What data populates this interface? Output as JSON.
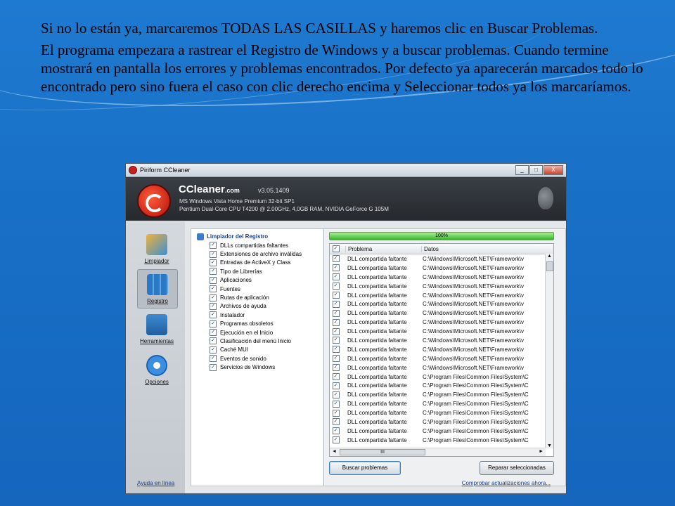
{
  "slide": {
    "paragraph1": "Si no lo están ya, marcaremos TODAS LAS CASILLAS y haremos clic en Buscar Problemas.",
    "paragraph2": "El programa empezara a rastrear el Registro de Windows y a buscar problemas. Cuando termine mostrará en pantalla los errores y problemas encontrados. Por defecto ya aparecerán marcados todo lo encontrado pero sino fuera el caso con clic derecho encima y Seleccionar todos ya los marcaríamos."
  },
  "window": {
    "title": "Piriform CCleaner",
    "controls": [
      "_",
      "□",
      "X"
    ]
  },
  "header": {
    "app_name": "CCleaner",
    "app_suffix": ".com",
    "version": "v3.05.1409",
    "os_line": "MS Windows Vista Home Premium 32-bit SP1",
    "cpu_line": "Pentium Dual-Core CPU T4200 @ 2.00GHz, 4,0GB RAM, NVIDIA GeForce G 105M"
  },
  "sidebar": {
    "items": [
      {
        "label": "Limpiador",
        "icon": "broom-icon"
      },
      {
        "label": "Registro",
        "icon": "registry-icon"
      },
      {
        "label": "Herramientas",
        "icon": "toolbox-icon"
      },
      {
        "label": "Opciones",
        "icon": "gear-icon"
      }
    ],
    "active": "Registro"
  },
  "tree": {
    "root": "Limpiador del Registro",
    "items": [
      "DLLs compartidas faltantes",
      "Extensiones de archivo inválidas",
      "Entradas de ActiveX y Class",
      "Tipo de Librerías",
      "Aplicaciones",
      "Fuentes",
      "Rutas de aplicación",
      "Archivos de ayuda",
      "Instalador",
      "Programas obsoletos",
      "Ejecución en el Inicio",
      "Clasificación del menú Inicio",
      "Caché MUI",
      "Eventos de sonido",
      "Servicios de Windows"
    ]
  },
  "progress": {
    "label": "100%",
    "value": 100
  },
  "results": {
    "columns": [
      "Problema",
      "Datos"
    ],
    "rows": [
      {
        "problem": "DLL compartida faltante",
        "data": "C:\\Windows\\Microsoft.NET\\Framework\\v"
      },
      {
        "problem": "DLL compartida faltante",
        "data": "C:\\Windows\\Microsoft.NET\\Framework\\v"
      },
      {
        "problem": "DLL compartida faltante",
        "data": "C:\\Windows\\Microsoft.NET\\Framework\\v"
      },
      {
        "problem": "DLL compartida faltante",
        "data": "C:\\Windows\\Microsoft.NET\\Framework\\v"
      },
      {
        "problem": "DLL compartida faltante",
        "data": "C:\\Windows\\Microsoft.NET\\Framework\\v"
      },
      {
        "problem": "DLL compartida faltante",
        "data": "C:\\Windows\\Microsoft.NET\\Framework\\v"
      },
      {
        "problem": "DLL compartida faltante",
        "data": "C:\\Windows\\Microsoft.NET\\Framework\\v"
      },
      {
        "problem": "DLL compartida faltante",
        "data": "C:\\Windows\\Microsoft.NET\\Framework\\v"
      },
      {
        "problem": "DLL compartida faltante",
        "data": "C:\\Windows\\Microsoft.NET\\Framework\\v"
      },
      {
        "problem": "DLL compartida faltante",
        "data": "C:\\Windows\\Microsoft.NET\\Framework\\v"
      },
      {
        "problem": "DLL compartida faltante",
        "data": "C:\\Windows\\Microsoft.NET\\Framework\\v"
      },
      {
        "problem": "DLL compartida faltante",
        "data": "C:\\Windows\\Microsoft.NET\\Framework\\v"
      },
      {
        "problem": "DLL compartida faltante",
        "data": "C:\\Windows\\Microsoft.NET\\Framework\\v"
      },
      {
        "problem": "DLL compartida faltante",
        "data": "C:\\Program Files\\Common Files\\System\\C"
      },
      {
        "problem": "DLL compartida faltante",
        "data": "C:\\Program Files\\Common Files\\System\\C"
      },
      {
        "problem": "DLL compartida faltante",
        "data": "C:\\Program Files\\Common Files\\System\\C"
      },
      {
        "problem": "DLL compartida faltante",
        "data": "C:\\Program Files\\Common Files\\System\\C"
      },
      {
        "problem": "DLL compartida faltante",
        "data": "C:\\Program Files\\Common Files\\System\\C"
      },
      {
        "problem": "DLL compartida faltante",
        "data": "C:\\Program Files\\Common Files\\System\\C"
      },
      {
        "problem": "DLL compartida faltante",
        "data": "C:\\Program Files\\Common Files\\System\\C"
      },
      {
        "problem": "DLL compartida faltante",
        "data": "C:\\Program Files\\Common Files\\System\\C"
      }
    ],
    "hscroll_label": "III"
  },
  "buttons": {
    "search": "Buscar problemas",
    "repair": "Reparar seleccionadas"
  },
  "footer": {
    "help": "Ayuda en línea",
    "update": "Comprobar actualizaciones ahora..."
  }
}
